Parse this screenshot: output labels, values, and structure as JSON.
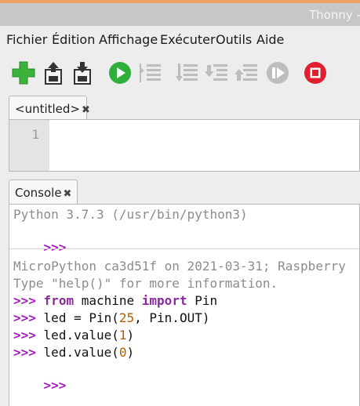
{
  "window": {
    "title": "Thonny -"
  },
  "menu": [
    "Fichier",
    "Édition",
    "Affichage",
    "Exécuter",
    "Outils",
    "Aide"
  ],
  "toolbar": {
    "icons": [
      "new-file-icon",
      "open-file-icon",
      "save-file-icon",
      "run-icon",
      "debug-icon",
      "step-over-icon",
      "step-into-icon",
      "step-out-icon",
      "resume-icon",
      "stop-icon"
    ],
    "colors": {
      "new": "#3bb33b",
      "run": "#2fae3a",
      "stop": "#e0202e",
      "disabled": "#bdbdbd"
    }
  },
  "editor": {
    "tab_label": "<untitled>",
    "close_glyph": "✖",
    "line_numbers": [
      "1"
    ]
  },
  "console": {
    "tab_label": "Console",
    "close_glyph": "✖",
    "prompt": ">>>",
    "session1": {
      "banner": "Python 3.7.3 (/usr/bin/python3)"
    },
    "session2": {
      "banner1": "MicroPython ca3d51f on 2021-03-31; Raspberry",
      "banner2": "Type \"help()\" for more information.",
      "lines": [
        {
          "kw1": "from",
          "mid": " machine ",
          "kw2": "import",
          "tail": " Pin"
        },
        {
          "pre": "led = Pin(",
          "num": "25",
          "post": ", Pin.OUT)"
        },
        {
          "pre": "led.value(",
          "num": "1",
          "post": ")"
        },
        {
          "pre": "led.value(",
          "num": "0",
          "post": ")"
        }
      ]
    }
  }
}
